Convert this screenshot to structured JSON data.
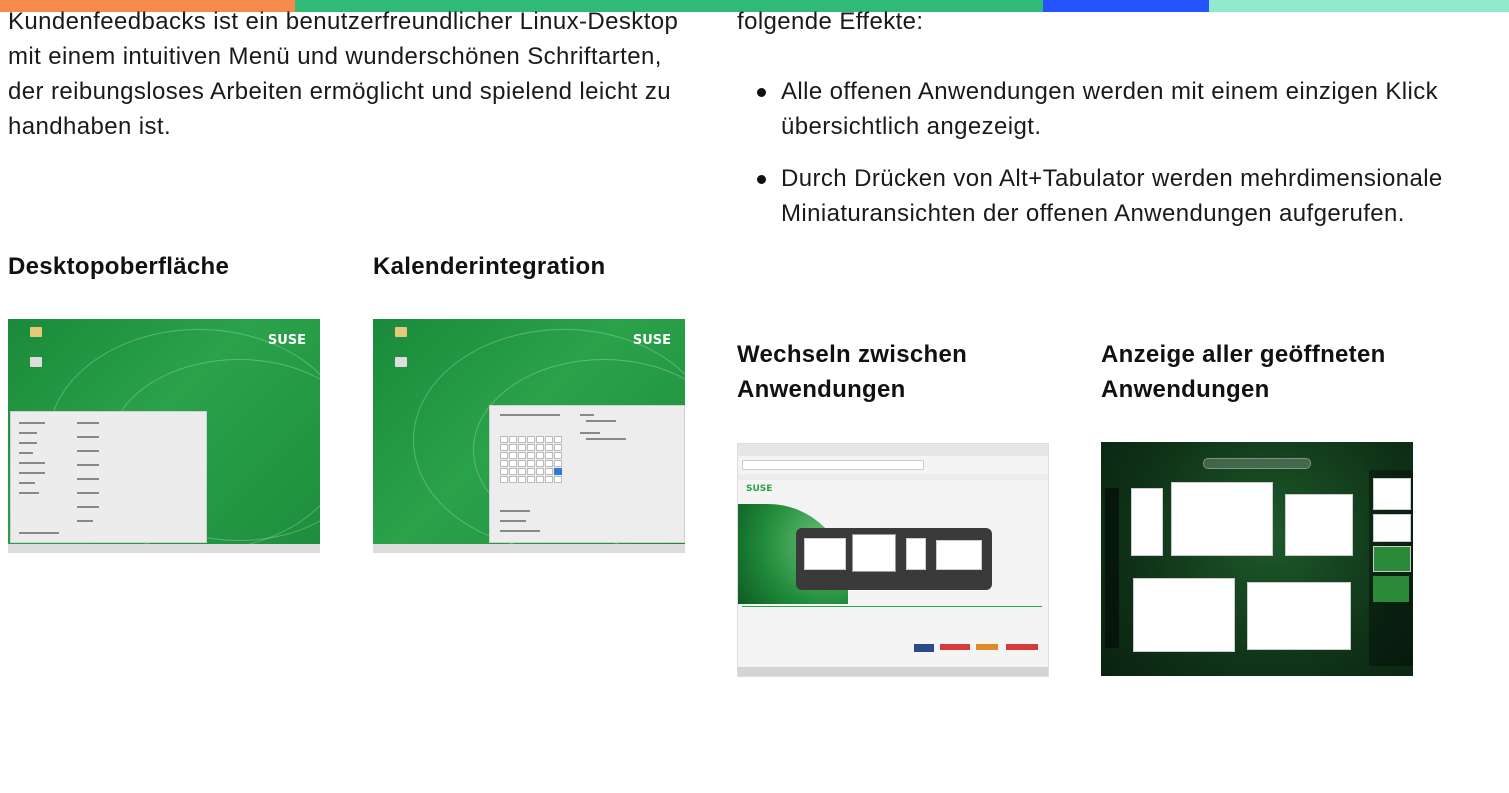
{
  "colors": {
    "bar_orange": "#f58a4b",
    "bar_green": "#30ba78",
    "bar_blue": "#2453ff",
    "bar_mint": "#90ebcd",
    "suse_green": "#2aa24a"
  },
  "left_column": {
    "paragraph": "Kundenfeedbacks ist ein benutzerfreundlicher Linux-Desktop mit einem intuitiven Menü und wunderschönen Schriftarten, der reibungsloses Arbeiten ermöglicht und spielend leicht zu handhaben ist."
  },
  "right_column": {
    "intro": "folgende Effekte:",
    "effects": [
      "Alle offenen Anwendungen werden mit einem einzigen Klick übersichtlich angezeigt.",
      "Durch Drücken von Alt+Tabulator werden mehrdimensionale Miniaturansichten der offenen Anwendungen aufgerufen."
    ]
  },
  "features": [
    {
      "title": "Desktopoberfläche",
      "image": "desktop-menu-screenshot"
    },
    {
      "title": "Kalenderintegration",
      "image": "calendar-screenshot"
    },
    {
      "title": "Wechseln zwischen Anwendungen",
      "image": "app-switcher-screenshot"
    },
    {
      "title": "Anzeige aller geöffneten Anwendungen",
      "image": "overview-screenshot"
    }
  ],
  "screenshot_text": {
    "logo": "SUSE"
  }
}
